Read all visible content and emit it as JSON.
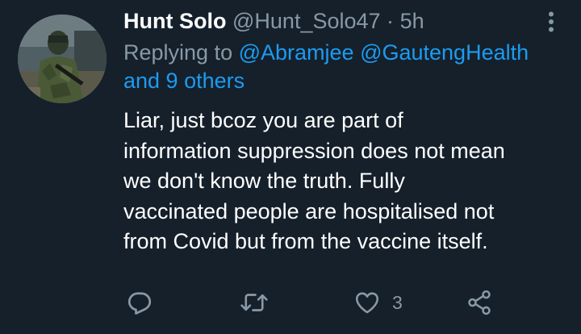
{
  "tweet": {
    "display_name": "Hunt Solo",
    "handle": "@Hunt_Solo47",
    "separator": "·",
    "time": "5h",
    "replying_prefix": "Replying to ",
    "mentions": [
      "@Abramjee",
      "@GautengHealth"
    ],
    "and_others": "and 9 others",
    "body_lines": [
      "Liar, just bcoz you are part of",
      "information suppression does not mean",
      "we don't know the truth. Fully",
      "vaccinated people are hospitalised not",
      "from Covid but from the vaccine itself."
    ],
    "like_count": "3"
  },
  "icons": {
    "more": "more-vertical-icon",
    "reply": "reply-bubble-icon",
    "retweet": "retweet-icon",
    "like": "heart-icon",
    "share": "share-icon"
  },
  "colors": {
    "background": "#15202b",
    "secondary_text": "#8899a6",
    "link": "#1d9bf0",
    "primary_text": "#ffffff"
  }
}
